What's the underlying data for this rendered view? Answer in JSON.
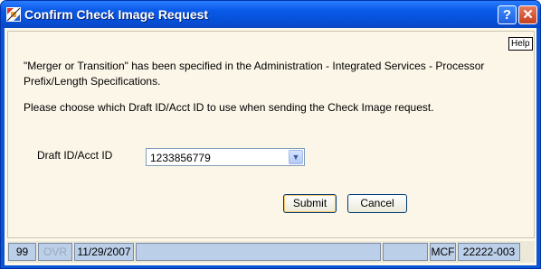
{
  "window": {
    "title": "Confirm Check Image Request",
    "help_button": "?",
    "close_button": "✕"
  },
  "dialog": {
    "help_label": "Help",
    "message_line1": "\"Merger or Transition\" has been specified in the Administration - Integrated Services - Processor Prefix/Length Specifications.",
    "message_line2": "Please choose which Draft ID/Acct ID to use when sending the Check Image request.",
    "draft_label": "Draft ID/Acct ID",
    "draft_value": "1233856779",
    "submit_label": "Submit",
    "cancel_label": "Cancel"
  },
  "statusbar": {
    "cells": [
      "99",
      "OVR",
      "11/29/2007",
      "",
      "",
      "MCF",
      "22222-003"
    ]
  },
  "colors": {
    "titlebar": "#0a5ae8",
    "dialog_background": "#fcf6e8",
    "status_cell": "#bccfe8",
    "close_button": "#c4401f"
  }
}
